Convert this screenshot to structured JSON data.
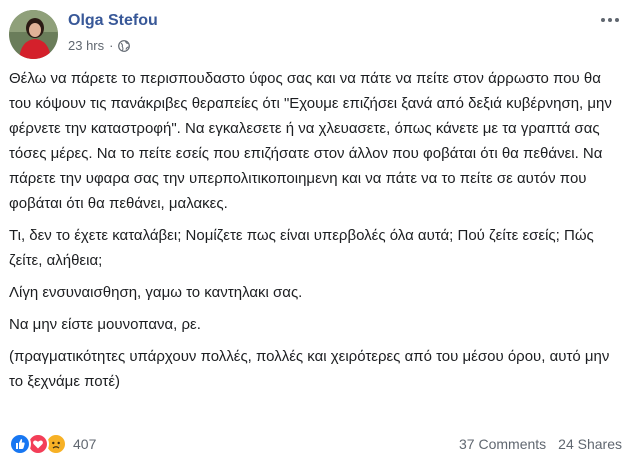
{
  "post": {
    "author": "Olga Stefou",
    "time": "23 hrs",
    "separator": "·",
    "privacy_icon": "globe-icon",
    "paragraphs": [
      "Θέλω να πάρετε το περισπουδαστο ύφος σας και να πάτε να πείτε στον άρρωστο που θα του κόψουν τις πανάκριβες θεραπείες ότι \"Εχουμε επιζήσει ξανά από δεξιά κυβέρνηση, μην φέρνετε την καταστροφή\". Να εγκαλεσετε ή να χλευασετε, όπως κάνετε με τα γραπτά σας τόσες μέρες. Να το πείτε εσείς που επιζήσατε στον άλλον που φοβάται ότι θα πεθάνει. Να πάρετε την υφαρα σας την υπερπολιτικοποιημενη και να πάτε να το πείτε σε αυτόν που φοβάται ότι θα πεθάνει, μαλακες.",
      "Τι, δεν το έχετε καταλάβει; Νομίζετε πως είναι υπερβολές όλα αυτά; Πού ζείτε εσείς; Πώς ζείτε, αλήθεια;",
      "Λίγη ενσυναισθηση, γαμω το καντηλακι σας.",
      "Να μην είστε μουνοπανα, ρε.",
      "(πραγματικότητες υπάρχουν πολλές, πολλές και χειρότερες από του μέσου όρου, αυτό μην το ξεχνάμε ποτέ)"
    ]
  },
  "footer": {
    "reaction_icons": [
      "like-icon",
      "love-icon",
      "sad-icon"
    ],
    "reaction_count": "407",
    "comments": "37 Comments",
    "shares": "24 Shares"
  },
  "colors": {
    "author": "#385898",
    "meta": "#606770",
    "like": "#1877f2",
    "love": "#f33e58",
    "sad": "#f7b125"
  }
}
